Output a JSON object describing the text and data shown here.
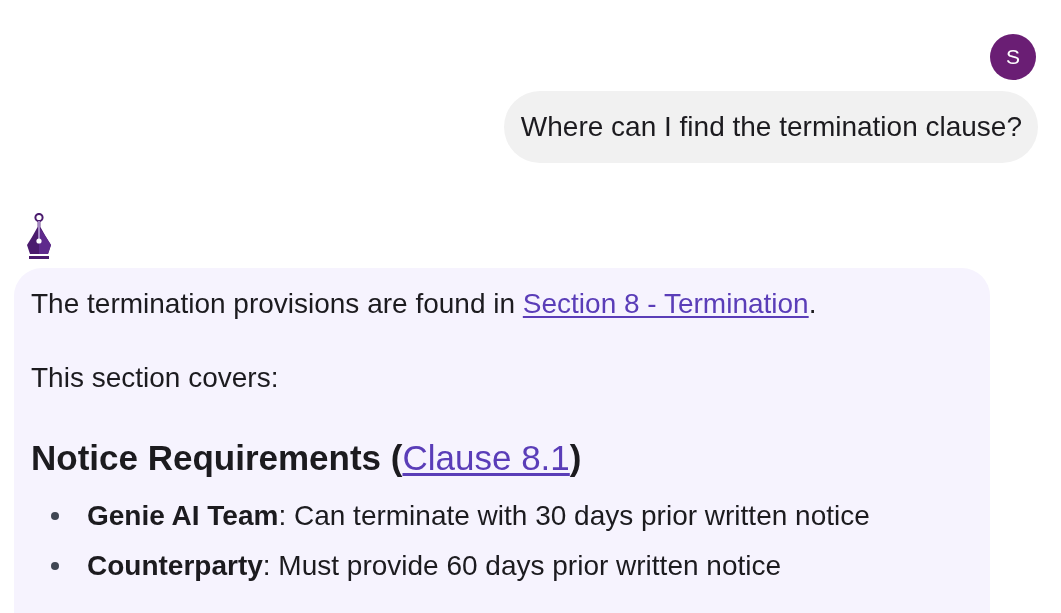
{
  "user_message": {
    "avatar_initial": "S",
    "text": "Where can I find the termination clause?"
  },
  "assistant_message": {
    "intro": {
      "text_before": "The termination provisions are found in ",
      "link": "Section 8 - Termination",
      "text_after": "."
    },
    "paragraph": "This section covers:",
    "section": {
      "heading_before": "Notice Requirements (",
      "heading_link": "Clause 8.1",
      "heading_after": ")",
      "items": [
        "**Genie AI Team**: Can terminate with 30 days prior written notice",
        "**Counterparty**: Must provide 60 days prior written notice"
      ]
    }
  }
}
